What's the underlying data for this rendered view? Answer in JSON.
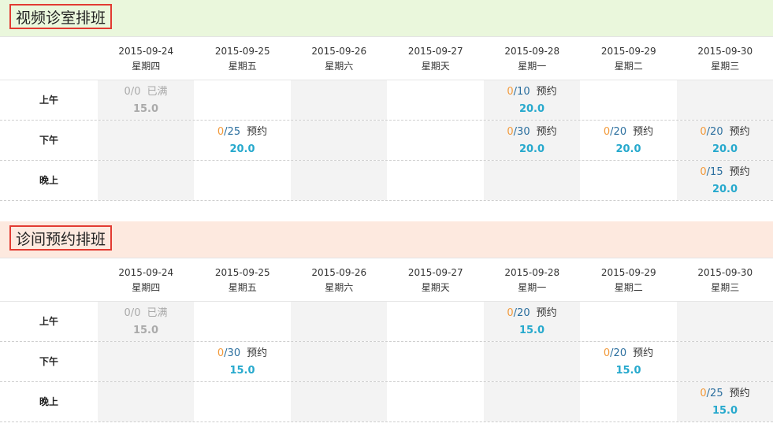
{
  "sections": [
    {
      "title": "视频诊室排班",
      "head_bg": "#eaf7dc",
      "days": [
        {
          "date": "2015-09-24",
          "weekday": "星期四"
        },
        {
          "date": "2015-09-25",
          "weekday": "星期五"
        },
        {
          "date": "2015-09-26",
          "weekday": "星期六"
        },
        {
          "date": "2015-09-27",
          "weekday": "星期天"
        },
        {
          "date": "2015-09-28",
          "weekday": "星期一"
        },
        {
          "date": "2015-09-29",
          "weekday": "星期二"
        },
        {
          "date": "2015-09-30",
          "weekday": "星期三"
        }
      ],
      "periods": [
        {
          "label": "上午",
          "slots": [
            {
              "used": "0",
              "cap": "0",
              "action": "已满",
              "price": "15.0",
              "full": true
            },
            null,
            null,
            null,
            {
              "used": "0",
              "cap": "10",
              "action": "预约",
              "price": "20.0",
              "full": false
            },
            null,
            null
          ]
        },
        {
          "label": "下午",
          "slots": [
            null,
            {
              "used": "0",
              "cap": "25",
              "action": "预约",
              "price": "20.0",
              "full": false
            },
            null,
            null,
            {
              "used": "0",
              "cap": "30",
              "action": "预约",
              "price": "20.0",
              "full": false
            },
            {
              "used": "0",
              "cap": "20",
              "action": "预约",
              "price": "20.0",
              "full": false
            },
            {
              "used": "0",
              "cap": "20",
              "action": "预约",
              "price": "20.0",
              "full": false
            }
          ]
        },
        {
          "label": "晚上",
          "slots": [
            null,
            null,
            null,
            null,
            null,
            null,
            {
              "used": "0",
              "cap": "15",
              "action": "预约",
              "price": "20.0",
              "full": false
            }
          ]
        }
      ]
    },
    {
      "title": "诊间预约排班",
      "head_bg": "#fde9df",
      "days": [
        {
          "date": "2015-09-24",
          "weekday": "星期四"
        },
        {
          "date": "2015-09-25",
          "weekday": "星期五"
        },
        {
          "date": "2015-09-26",
          "weekday": "星期六"
        },
        {
          "date": "2015-09-27",
          "weekday": "星期天"
        },
        {
          "date": "2015-09-28",
          "weekday": "星期一"
        },
        {
          "date": "2015-09-29",
          "weekday": "星期二"
        },
        {
          "date": "2015-09-30",
          "weekday": "星期三"
        }
      ],
      "periods": [
        {
          "label": "上午",
          "slots": [
            {
              "used": "0",
              "cap": "0",
              "action": "已满",
              "price": "15.0",
              "full": true
            },
            null,
            null,
            null,
            {
              "used": "0",
              "cap": "20",
              "action": "预约",
              "price": "15.0",
              "full": false
            },
            null,
            null
          ]
        },
        {
          "label": "下午",
          "slots": [
            null,
            {
              "used": "0",
              "cap": "30",
              "action": "预约",
              "price": "15.0",
              "full": false
            },
            null,
            null,
            null,
            {
              "used": "0",
              "cap": "20",
              "action": "预约",
              "price": "15.0",
              "full": false
            },
            null
          ]
        },
        {
          "label": "晚上",
          "slots": [
            null,
            null,
            null,
            null,
            null,
            null,
            {
              "used": "0",
              "cap": "25",
              "action": "预约",
              "price": "15.0",
              "full": false
            }
          ]
        }
      ]
    }
  ]
}
